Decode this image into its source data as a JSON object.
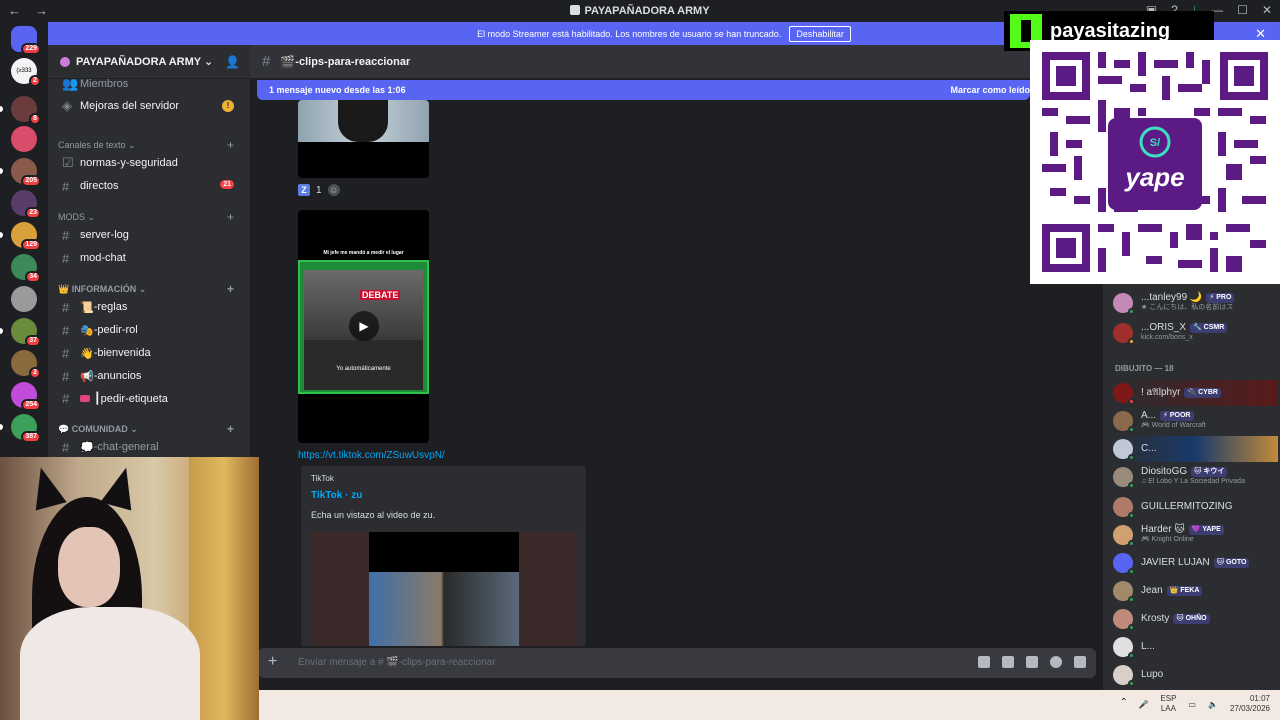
{
  "window": {
    "title": "PAYAPAÑADORA ARMY"
  },
  "banner": {
    "text": "El modo Streamer está habilitado. Los nombres de usuario se han truncado.",
    "button": "Deshabilitar"
  },
  "server": {
    "name": "PAYAPAÑADORA ARMY ⌄"
  },
  "rail": {
    "badges": [
      "229",
      "2",
      "8",
      "205",
      "23",
      "129",
      "34",
      "37",
      "2",
      "254",
      "387"
    ],
    "top_label": "(≥333"
  },
  "sidebar": {
    "miembros": "Miembros",
    "mejoras": "Mejoras del servidor",
    "cat_texto": "Canales de texto ⌄",
    "ch_normas": "normas-y-seguridad",
    "ch_directos": "directos",
    "ch_directos_count": "21",
    "cat_mods": "MODS ⌄",
    "ch_serverlog": "server-log",
    "ch_modchat": "mod-chat",
    "cat_info": "INFORMACIÓN ⌄",
    "ch_reglas": "-reglas",
    "ch_pedirrol": "-pedir-rol",
    "ch_bienvenida": "-bienvenida",
    "ch_anuncios": "-anuncios",
    "ch_etiqueta": "┃pedir-etiqueta",
    "cat_comunidad": "COMUNIDAD ⌄",
    "ch_chatgeneral": "-chat-general"
  },
  "channel": {
    "name": "-clips-para-reaccionar"
  },
  "new_messages": {
    "text": "1 mensaje nuevo desde las 1:06",
    "mark": "Marcar como leído"
  },
  "messages": {
    "reaction_count": "1",
    "video_caption_top": "Mi jefe me mandó a medir el lugar",
    "video_caption_bottom": "Yo automáticamente",
    "video_title": "DEBATE",
    "link": "https://vt.tiktok.com/ZSuwUsvpN/",
    "embed_provider": "TikTok",
    "embed_title": "TikTok · zu",
    "embed_desc": "Echa un vistazo al video de zu."
  },
  "composer": {
    "placeholder": "Enviar mensaje a # 🎬-clips-para-reaccionar"
  },
  "overlay": {
    "kick_name": "payasitazing",
    "qr_brand": "yape"
  },
  "members": {
    "category": "DIBUJITO — 18",
    "list": [
      {
        "name": "...tanley99 🌙",
        "tag": "⚡ PRO",
        "status": "★ こんにちは、私の名前はス"
      },
      {
        "name": "...ORIS_X",
        "tag": "🔧 CSMR",
        "status": "kick.com/boris_x"
      },
      {
        "name": "! a𝔄lphyr",
        "tag": "🔌 CYBR",
        "status": ""
      },
      {
        "name": "A...",
        "tag": "⚡ POOR",
        "status": "🎮 World of Warcraft"
      },
      {
        "name": "C...",
        "tag": "",
        "status": ""
      },
      {
        "name": "DiositoGG",
        "tag": "🐱 キウイ",
        "status": "♫ El Lobo Y La Sociedad Privada"
      },
      {
        "name": "GUILLERMITOZING",
        "tag": "",
        "status": ""
      },
      {
        "name": "Harder 🐱",
        "tag": "💜 YAPE",
        "status": "🎮 Knight Online"
      },
      {
        "name": "JAVIER LUJAN",
        "tag": "🐱 GOTO",
        "status": ""
      },
      {
        "name": "Jean",
        "tag": "👑 FEKA",
        "status": ""
      },
      {
        "name": "Krosty",
        "tag": "🐱 OHÑO",
        "status": ""
      },
      {
        "name": "L...",
        "tag": "",
        "status": ""
      },
      {
        "name": "Lupo",
        "tag": "",
        "status": ""
      }
    ]
  },
  "taskbar": {
    "lang1": "ESP",
    "lang2": "LAA",
    "time": "01:07",
    "date": "27/03/2026"
  },
  "colors": {
    "accent": "#5865f2",
    "kick_green": "#53fc18",
    "yape_purple": "#5c1a84"
  }
}
